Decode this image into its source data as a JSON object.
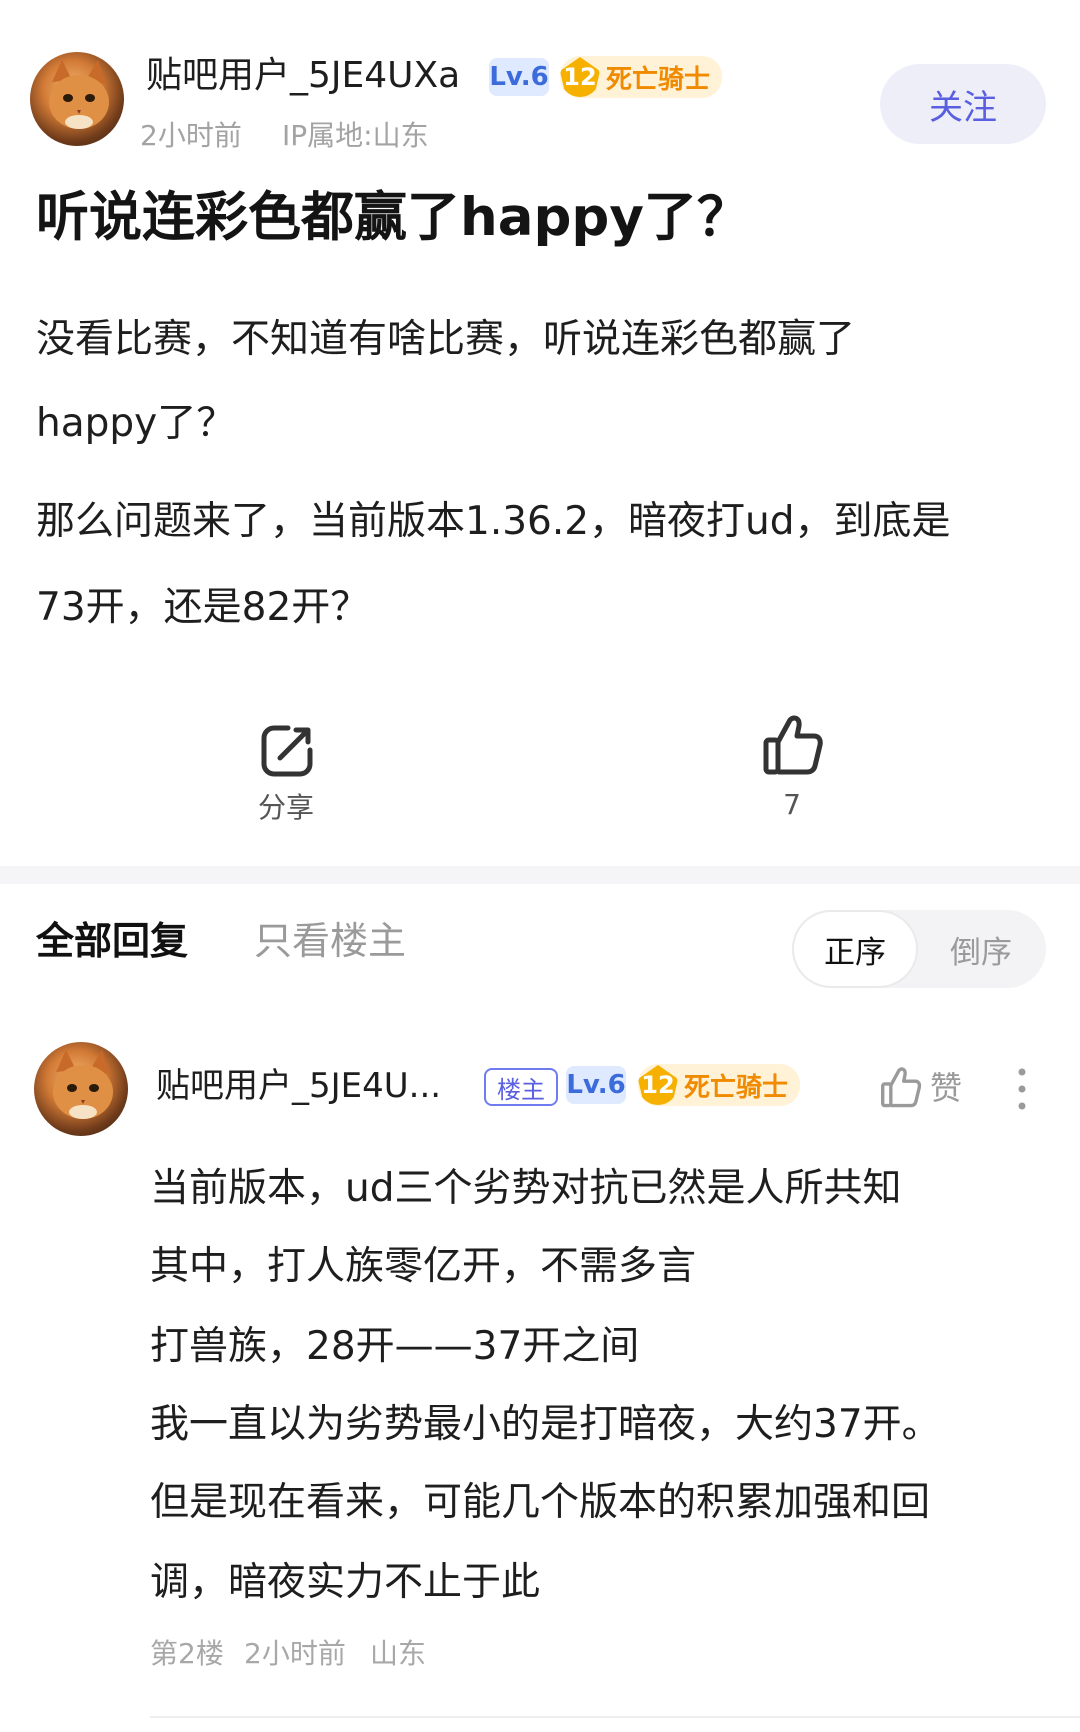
{
  "post": {
    "author": {
      "username": "贴吧用户_5JE4UXa",
      "level": "Lv.6",
      "title_badge": {
        "number": "12",
        "name": "死亡骑士"
      },
      "time": "2小时前",
      "ip_location": "IP属地:山东"
    },
    "follow_label": "关注",
    "title": "听说连彩色都赢了happy了？",
    "body_lines": [
      "没看比赛，不知道有啥比赛，听说连彩色都赢了",
      "happy了？",
      "那么问题来了，当前版本1.36.2，暗夜打ud，到底是",
      "73开，还是82开？"
    ],
    "actions": {
      "share_label": "分享",
      "like_count": "7"
    }
  },
  "reply_tabs": {
    "all_replies": "全部回复",
    "op_only": "只看楼主",
    "sort_asc": "正序",
    "sort_desc": "倒序"
  },
  "reply": {
    "author": {
      "username": "贴吧用户_5JE4U...",
      "op_badge": "楼主",
      "level": "Lv.6",
      "title_badge": {
        "number": "12",
        "name": "死亡骑士"
      }
    },
    "like_label": "赞",
    "body_lines": [
      "当前版本，ud三个劣势对抗已然是人所共知",
      "其中，打人族零亿开，不需多言",
      "打兽族，28开——37开之间",
      "我一直以为劣势最小的是打暗夜，大约37开。",
      "但是现在看来，可能几个版本的积累加强和回",
      "调，暗夜实力不止于此"
    ],
    "meta": {
      "floor": "第2楼",
      "time": "2小时前",
      "location": "山东"
    }
  },
  "colors": {
    "accent": "#5a5fe0",
    "level_badge_bg": "#dfe9ff",
    "title_badge_fg": "#f08a00"
  },
  "icons": [
    "cat-avatar",
    "share-icon",
    "thumbs-up-icon",
    "more-vertical-icon"
  ]
}
